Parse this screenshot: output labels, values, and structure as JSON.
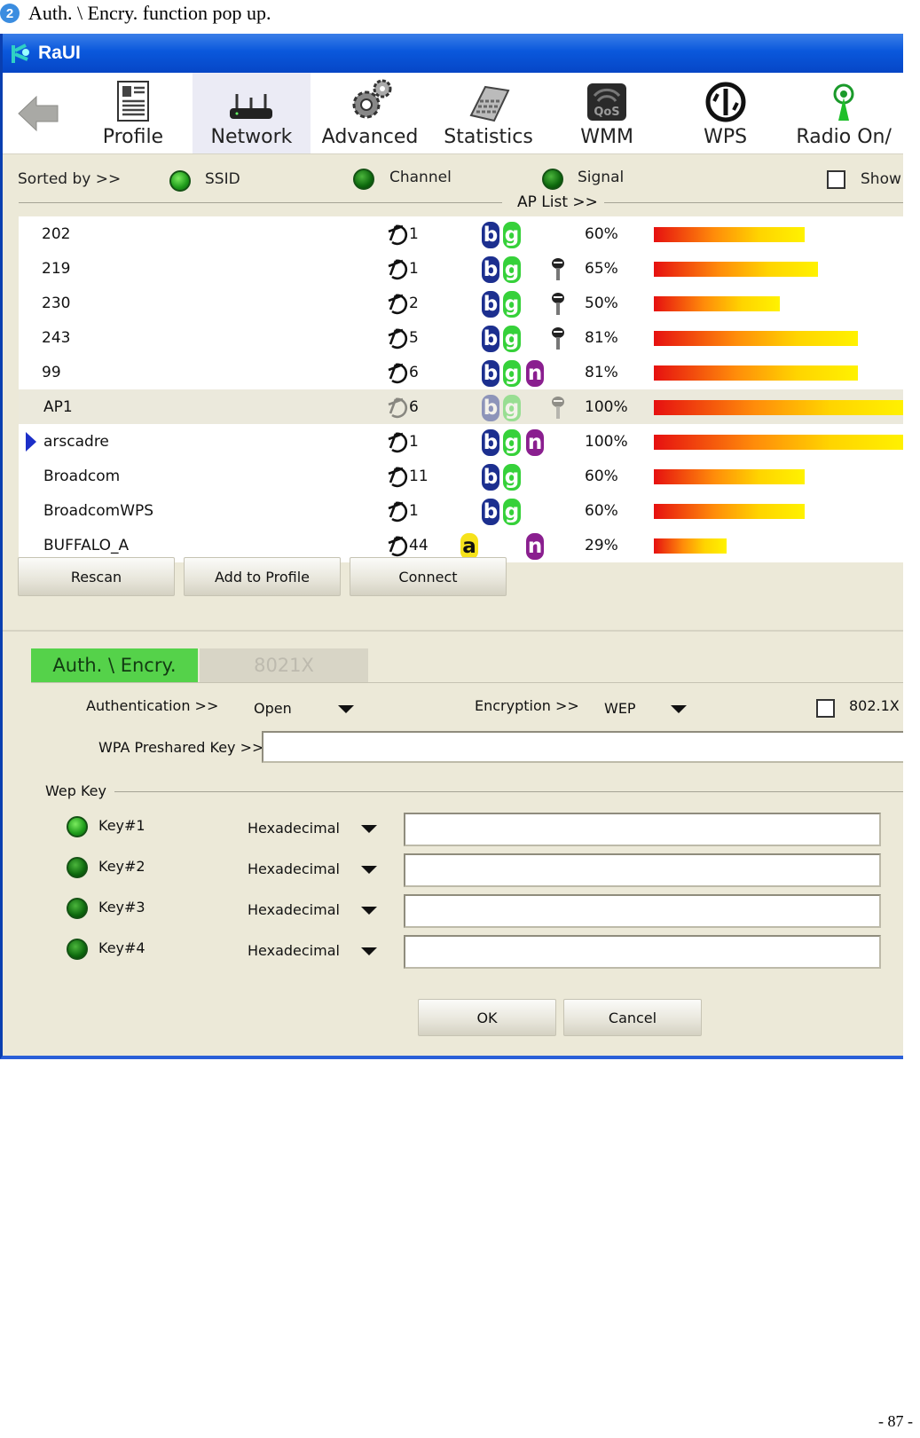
{
  "caption": {
    "number": "2",
    "text": "Auth. \\ Encry. function pop up."
  },
  "window": {
    "title": "RaUI"
  },
  "toolbar": {
    "items": [
      {
        "label": "Profile"
      },
      {
        "label": "Network"
      },
      {
        "label": "Advanced"
      },
      {
        "label": "Statistics"
      },
      {
        "label": "WMM"
      },
      {
        "label": "WPS"
      },
      {
        "label": "Radio On/"
      }
    ],
    "active": "Network"
  },
  "sortbar": {
    "sorted_by": "Sorted by >>",
    "ssid": "SSID",
    "channel": "Channel",
    "signal": "Signal",
    "show": "Show"
  },
  "aplist": {
    "label": "AP List >>",
    "rows": [
      {
        "ssid": "202",
        "channel": "1",
        "modes": [
          "b",
          "g"
        ],
        "lock": false,
        "signal": "60%",
        "pct": 60
      },
      {
        "ssid": "219",
        "channel": "1",
        "modes": [
          "b",
          "g"
        ],
        "lock": true,
        "signal": "65%",
        "pct": 65
      },
      {
        "ssid": "230",
        "channel": "2",
        "modes": [
          "b",
          "g"
        ],
        "lock": true,
        "signal": "50%",
        "pct": 50
      },
      {
        "ssid": "243",
        "channel": "5",
        "modes": [
          "b",
          "g"
        ],
        "lock": true,
        "signal": "81%",
        "pct": 81
      },
      {
        "ssid": "99",
        "channel": "6",
        "modes": [
          "b",
          "g",
          "n"
        ],
        "lock": false,
        "signal": "81%",
        "pct": 81
      },
      {
        "ssid": "AP1",
        "channel": "6",
        "modes": [
          "b",
          "g"
        ],
        "lock": true,
        "signal": "100%",
        "pct": 100,
        "selected": true
      },
      {
        "ssid": "arscadre",
        "channel": "1",
        "modes": [
          "b",
          "g",
          "n"
        ],
        "lock": false,
        "signal": "100%",
        "pct": 100,
        "connected": true
      },
      {
        "ssid": "Broadcom",
        "channel": "11",
        "modes": [
          "b",
          "g"
        ],
        "lock": false,
        "signal": "60%",
        "pct": 60
      },
      {
        "ssid": "BroadcomWPS",
        "channel": "1",
        "modes": [
          "b",
          "g"
        ],
        "lock": false,
        "signal": "60%",
        "pct": 60
      },
      {
        "ssid": "BUFFALO_A",
        "channel": "44",
        "modes": [
          "a",
          "n"
        ],
        "lock": false,
        "signal": "29%",
        "pct": 29
      }
    ]
  },
  "buttons": {
    "rescan": "Rescan",
    "add_profile": "Add to Profile",
    "connect": "Connect",
    "ok": "OK",
    "cancel": "Cancel"
  },
  "tabs": {
    "auth": "Auth. \\ Encry.",
    "x8021": "8021X"
  },
  "auth": {
    "authentication_label": "Authentication >>",
    "authentication_value": "Open",
    "encryption_label": "Encryption >>",
    "encryption_value": "WEP",
    "x8021_label": "802.1X",
    "wpa_psk_label": "WPA Preshared Key >>",
    "wep_key_label": "Wep Key",
    "keys": [
      {
        "label": "Key#1",
        "format": "Hexadecimal"
      },
      {
        "label": "Key#2",
        "format": "Hexadecimal"
      },
      {
        "label": "Key#3",
        "format": "Hexadecimal"
      },
      {
        "label": "Key#4",
        "format": "Hexadecimal"
      }
    ]
  },
  "page_number": "- 87 -",
  "colors": {
    "titlebar": "#0a58dc",
    "window_bg": "#ece9d8",
    "active_tab": "#55d24a",
    "signal_start": "#e61010",
    "signal_end": "#fff200"
  }
}
